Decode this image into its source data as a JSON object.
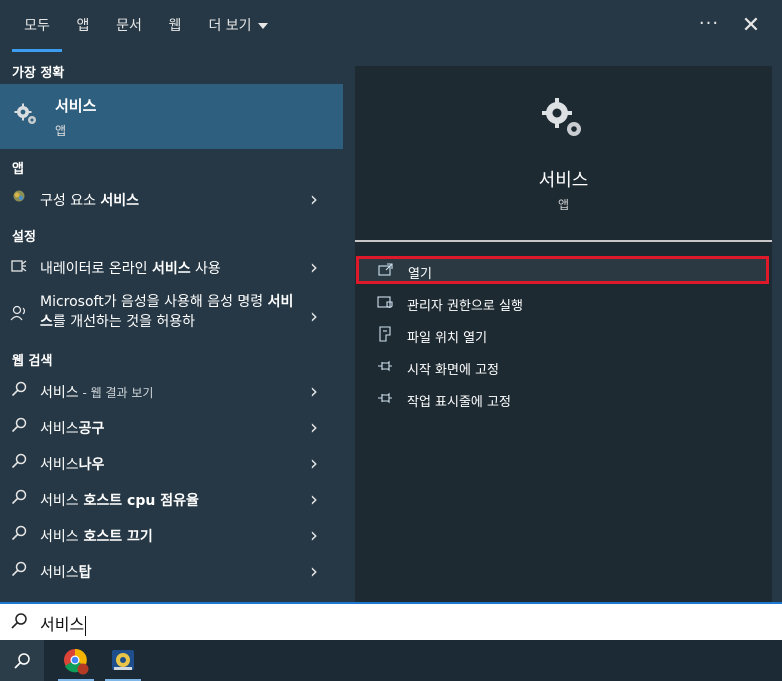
{
  "tabs": [
    {
      "label": "모두",
      "active": true
    },
    {
      "label": "앱",
      "active": false
    },
    {
      "label": "문서",
      "active": false
    },
    {
      "label": "웹",
      "active": false
    },
    {
      "label": "더 보기",
      "active": false
    }
  ],
  "toolbar": {
    "more_label": "···",
    "close_label": "✕"
  },
  "left": {
    "best_match_header": "가장 정확",
    "best_match": {
      "name": "서비스",
      "type": "앱"
    },
    "apps_header": "앱",
    "apps": [
      {
        "prefix": "구성 요소 ",
        "bold": "서비스",
        "suffix": ""
      }
    ],
    "settings_header": "설정",
    "settings": [
      {
        "prefix": "내레이터로 온라인 ",
        "bold": "서비스",
        "suffix": " 사용"
      },
      {
        "prefix": "Microsoft가 음성을 사용해 음성 명령 ",
        "bold": "서비스",
        "suffix": "를 개선하는 것을 허용하"
      }
    ],
    "web_header": "웹 검색",
    "web": [
      {
        "prefix": "서비스",
        "bold": "",
        "suffix": "",
        "muted": " - 웹 결과 보기"
      },
      {
        "prefix": "서비스",
        "bold": "공구",
        "suffix": "",
        "muted": ""
      },
      {
        "prefix": "서비스",
        "bold": "나우",
        "suffix": "",
        "muted": ""
      },
      {
        "prefix": "서비스",
        "bold": " 호스트 cpu 점유율",
        "suffix": "",
        "muted": ""
      },
      {
        "prefix": "서비스",
        "bold": " 호스트 끄기",
        "suffix": "",
        "muted": ""
      },
      {
        "prefix": "서비스",
        "bold": "탑",
        "suffix": "",
        "muted": ""
      }
    ]
  },
  "detail": {
    "title": "서비스",
    "type": "앱",
    "actions": [
      {
        "label": "열기",
        "icon": "open-icon"
      },
      {
        "label": "관리자 권한으로 실행",
        "icon": "shield-icon"
      },
      {
        "label": "파일 위치 열기",
        "icon": "file-location-icon"
      },
      {
        "label": "시작 화면에 고정",
        "icon": "pin-icon"
      },
      {
        "label": "작업 표시줄에 고정",
        "icon": "pin-icon"
      }
    ]
  },
  "search": {
    "value": "서비스"
  },
  "colors": {
    "accent": "#3b9cf0",
    "highlight": "#e0192a",
    "selected_row": "#2e5f7e"
  }
}
